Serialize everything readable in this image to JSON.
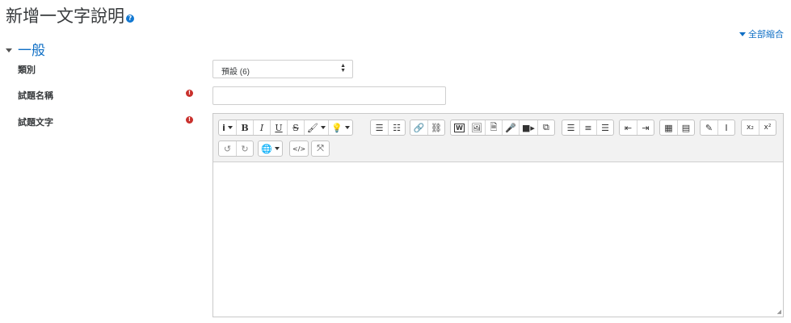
{
  "header": {
    "title": "新增一文字說明",
    "help_icon": "?"
  },
  "collapse_all": "全部縮合",
  "section": {
    "title": "一般"
  },
  "fields": {
    "category": {
      "label": "類別",
      "value": "預設 (6)"
    },
    "question_name": {
      "label": "試題名稱",
      "value": "",
      "required": "!"
    },
    "question_text": {
      "label": "試題文字",
      "required": "!"
    }
  },
  "colors": {
    "accent": "#0f6fc5",
    "required": "#c9302c"
  },
  "toolbar": {
    "info": "i",
    "bold": "B",
    "italic": "I",
    "underline": "U",
    "strike": "S",
    "subscript": "x₂",
    "superscript": "x²",
    "code": "</>",
    "word": "W"
  }
}
